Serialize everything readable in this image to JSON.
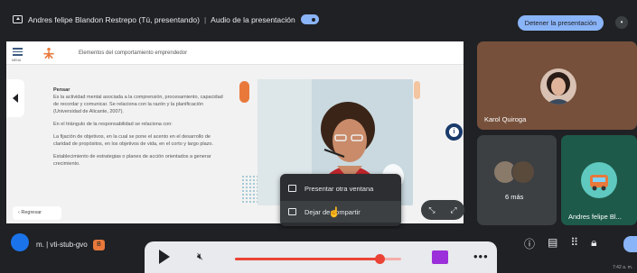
{
  "topbar": {
    "presenting_text": "Andres felipe Blandon Restrepo (Tú, presentando)",
    "audio_label": "Audio de la presentación",
    "stop_button": "Detener la presentación",
    "audio_toggle_on": true
  },
  "slide": {
    "menu_label": "MENU",
    "title": "Elementos del comportamiento emprendedor",
    "paragraphs": [
      {
        "strong": "Pensar",
        "text": "Es la actividad mental asociada a la comprensión, procesamiento, capacidad de recordar y comunicar. Se relaciona con la razón y la planificación (Universidad de Alicante, 2007)."
      },
      {
        "strong": "",
        "text": "En el triángulo de la responsabilidad se relaciona con:"
      },
      {
        "strong": "",
        "text": "La fijación de objetivos, en la cual se pone el acento en el desarrollo de claridad de propósitos, en los objetivos de vida, en el corto y largo plazo."
      },
      {
        "strong": "",
        "text": "Establecimiento de estrategias o planes de acción orientados a generar crecimiento."
      }
    ],
    "back_button": "‹ Regresar",
    "info_button": "i"
  },
  "context_menu": {
    "items": [
      {
        "label": "Presentar otra ventana",
        "icon": "window-icon"
      },
      {
        "label": "Dejar de compartir",
        "icon": "stop-share-icon"
      }
    ]
  },
  "participants": [
    {
      "name": "Karol Quiroga"
    },
    {
      "name": "6 más"
    },
    {
      "name": "Andres felipe Bl..."
    }
  ],
  "bottombar": {
    "meeting_code": "m.  |  vti-stub-gvo",
    "code_badge": "B"
  },
  "player": {
    "progress": 0.87
  },
  "status": {
    "clock": "7:42 a. m."
  },
  "colors": {
    "accent": "#8ab4f8",
    "sena_orange": "#e8793b",
    "progress_red": "#ea4335",
    "background": "#202124"
  }
}
